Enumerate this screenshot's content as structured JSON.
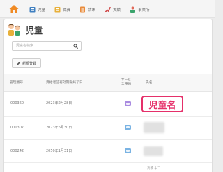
{
  "nav": {
    "items": [
      {
        "label": "児童",
        "icon": "child-icon"
      },
      {
        "label": "職員",
        "icon": "staff-icon"
      },
      {
        "label": "請求",
        "icon": "invoice-icon"
      },
      {
        "label": "実績",
        "icon": "record-icon"
      },
      {
        "label": "事業所",
        "icon": "office-icon"
      }
    ]
  },
  "page": {
    "title": "児童"
  },
  "search": {
    "placeholder": "児童名検索"
  },
  "actions": {
    "new_label": "新規登録"
  },
  "table": {
    "headers": {
      "number": "管理番号",
      "cert_date": "受給者証有効期限終了日",
      "service": "サービス種類",
      "name": "氏名"
    },
    "rows": [
      {
        "number": "000360",
        "date": "2023年2月28日"
      },
      {
        "number": "000307",
        "date": "2023年6月30日"
      },
      {
        "number": "000242",
        "date": "2050年1月31日"
      }
    ],
    "partial_name": "高橋 十二"
  },
  "callout": {
    "text": "児童名"
  },
  "colors": {
    "accent": "#e5306a",
    "service_purple": "#a98be0",
    "service_blue": "#7ab3e3"
  }
}
